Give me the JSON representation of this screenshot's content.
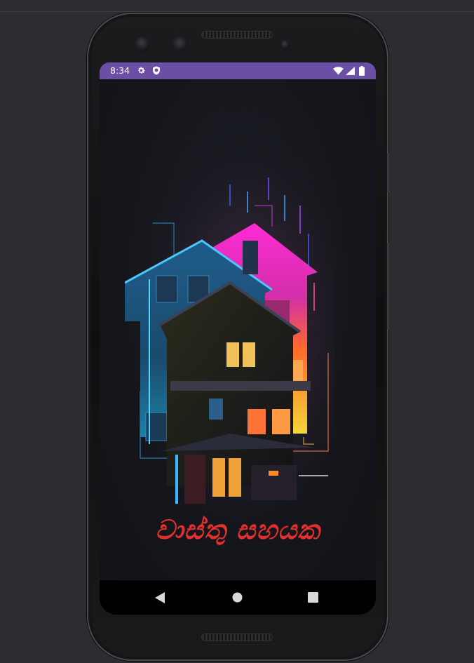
{
  "status_bar": {
    "time": "8:34",
    "icons": [
      "settings-gear-icon",
      "shield-icon",
      "wifi-icon",
      "cell-signal-icon",
      "battery-icon"
    ],
    "background_color": "#6a4fa5"
  },
  "splash": {
    "app_title": "වාස්තු සහයක",
    "title_color": "#e52f2f",
    "illustration": "neon-house-illustration"
  },
  "nav_bar": {
    "buttons": [
      "back-triangle-icon",
      "home-circle-icon",
      "recents-square-icon"
    ]
  }
}
